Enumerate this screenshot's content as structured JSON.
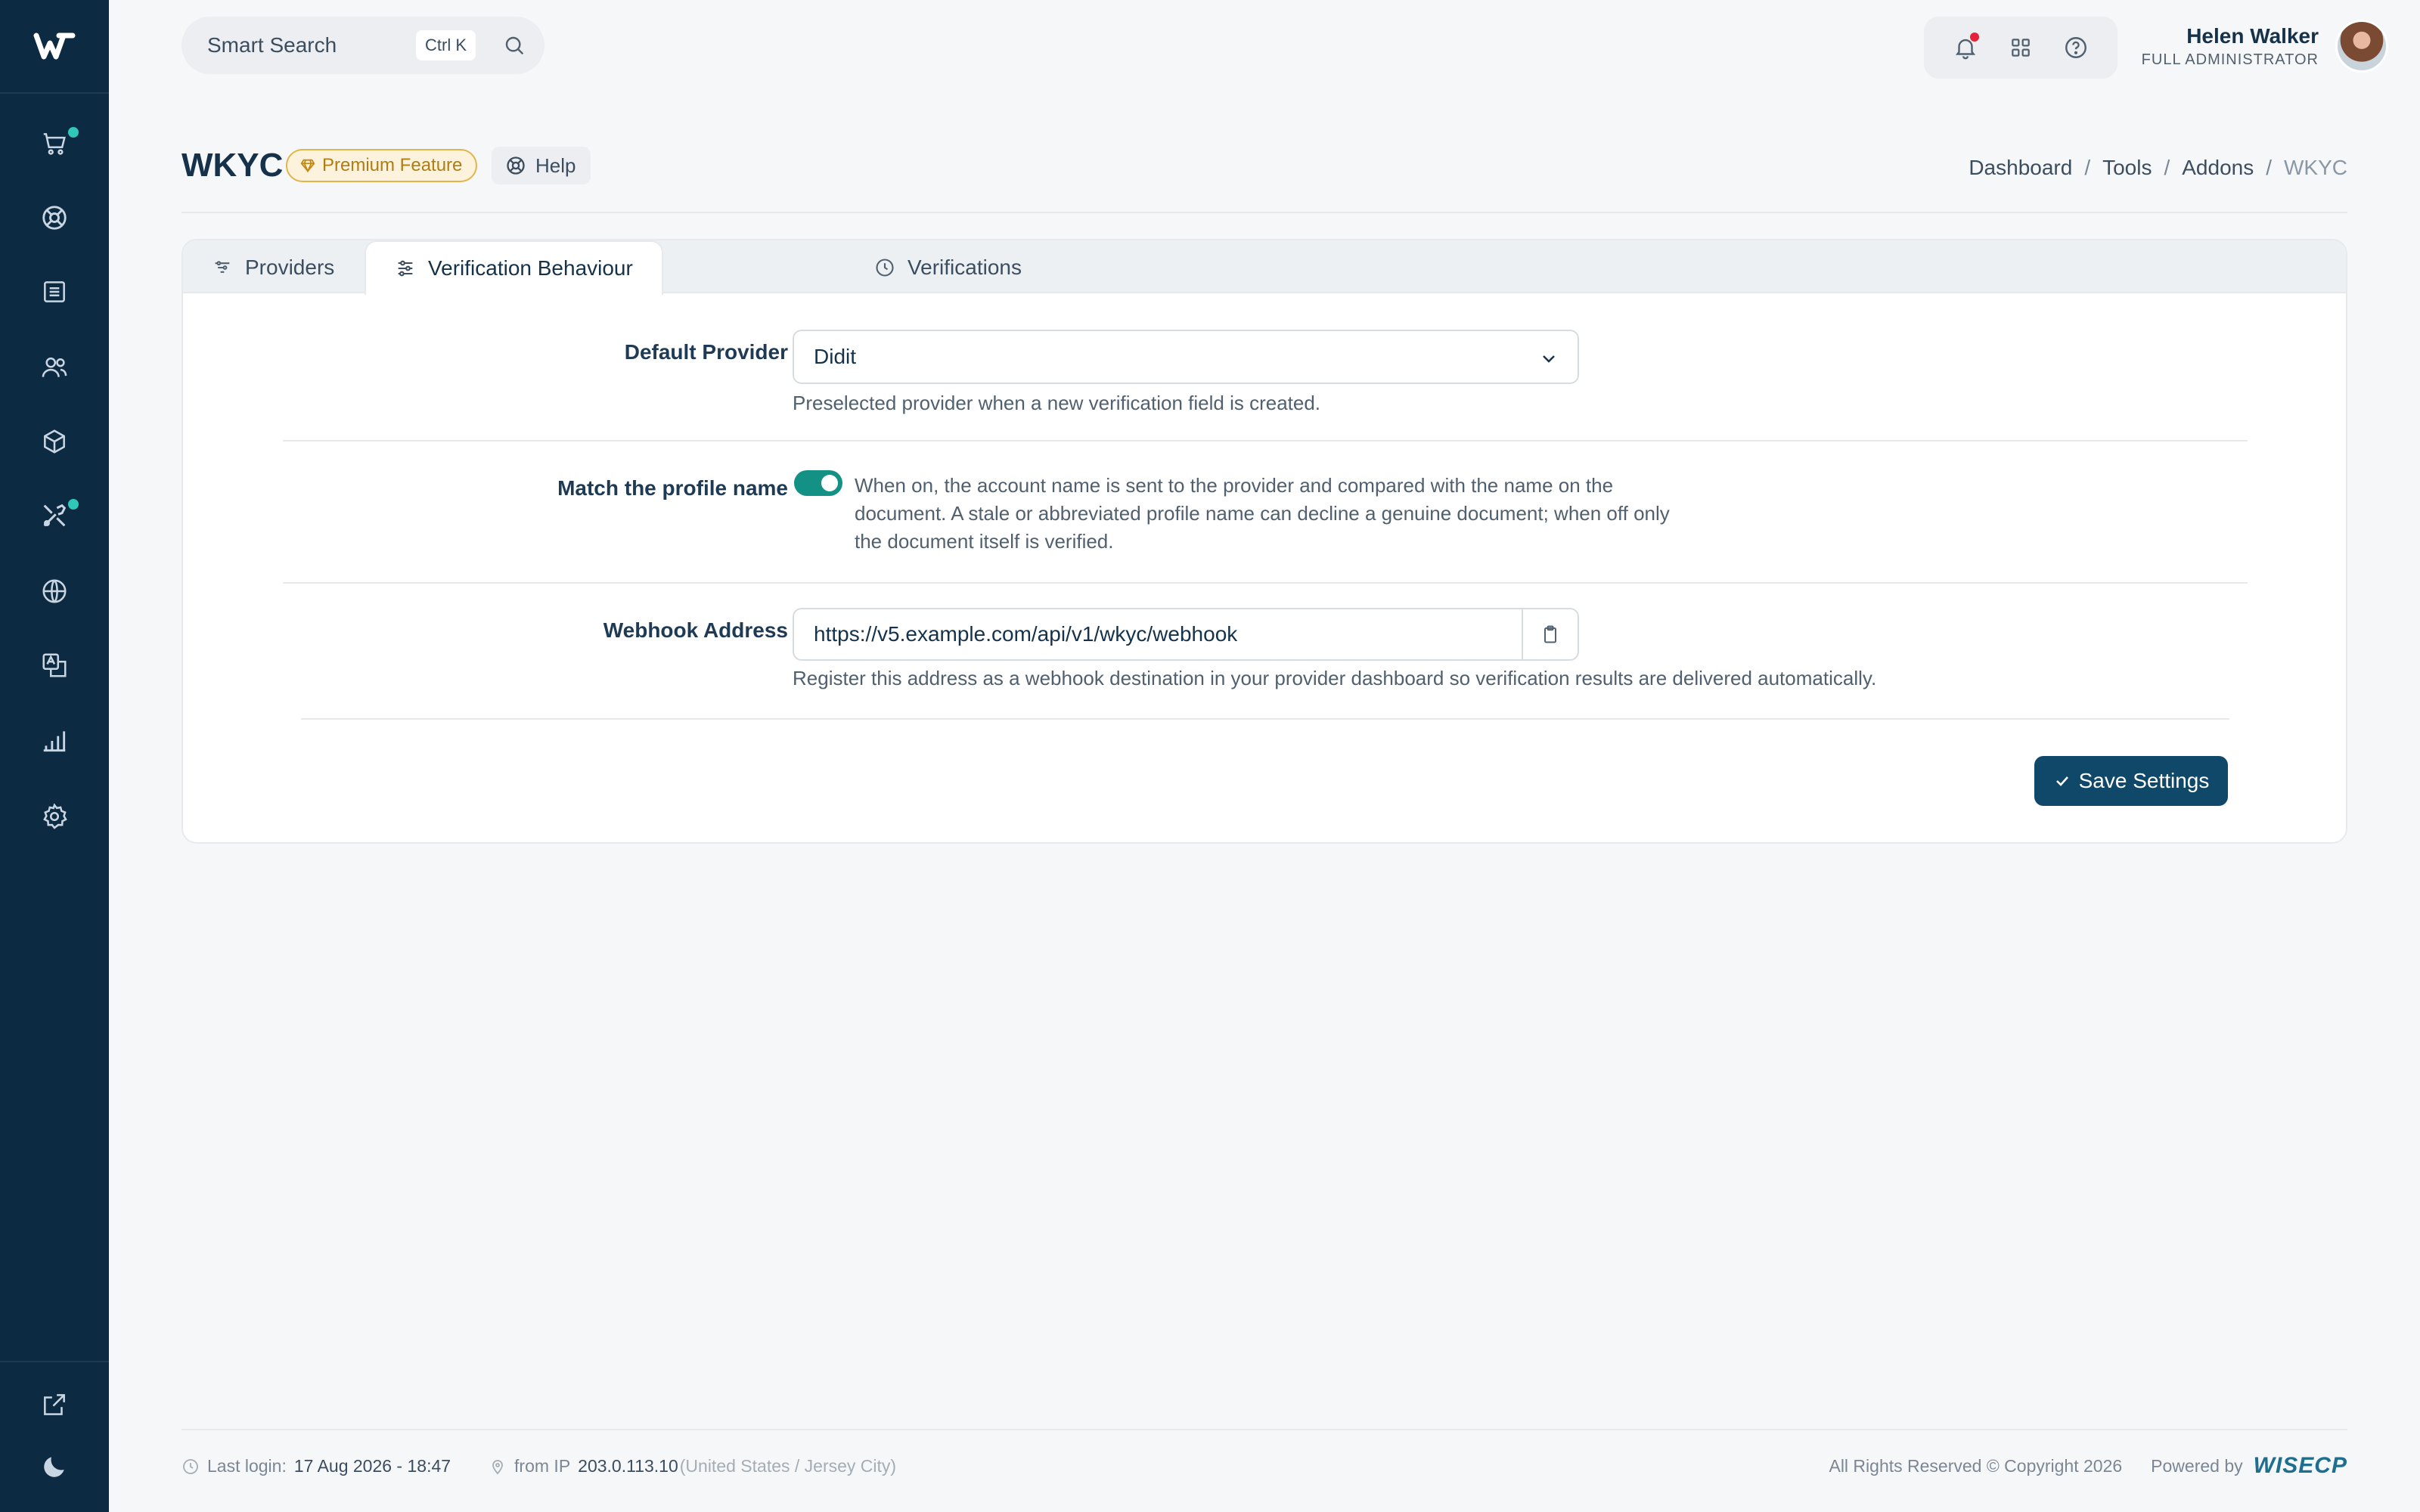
{
  "app": {
    "brand_initial": "W"
  },
  "search": {
    "placeholder": "Smart Search",
    "shortcut": "Ctrl K"
  },
  "user": {
    "name": "Helen Walker",
    "role": "FULL ADMINISTRATOR"
  },
  "header": {
    "title": "WKYC",
    "premium_badge": "Premium Feature",
    "help_label": "Help",
    "breadcrumb": [
      "Dashboard",
      "Tools",
      "Addons",
      "WKYC"
    ]
  },
  "tabs": [
    {
      "label": "Providers",
      "icon": "sliders-icon"
    },
    {
      "label": "Verification Behaviour",
      "icon": "settings-sliders-icon",
      "active": true
    },
    {
      "label": "Verifications",
      "icon": "clock-icon"
    }
  ],
  "form": {
    "default_provider": {
      "label": "Default Provider",
      "value": "Didit",
      "hint": "Preselected provider when a new verification field is created."
    },
    "match_profile": {
      "label": "Match the profile name",
      "enabled": true,
      "description": "When on, the account name is sent to the provider and compared with the name on the document. A stale or abbreviated profile name can decline a genuine document; when off only the document itself is verified."
    },
    "webhook": {
      "label": "Webhook Address",
      "value": "https://v5.example.com/api/v1/wkyc/webhook",
      "hint": "Register this address as a webhook destination in your provider dashboard so verification results are delivered automatically."
    },
    "save_label": "Save Settings"
  },
  "footer": {
    "last_login_label": "Last login:",
    "last_login_value": "17 Aug 2026 - 18:47",
    "ip_label": "from IP",
    "ip_value": "203.0.113.10",
    "ip_location": "(United States / Jersey City)",
    "copyright": "All Rights Reserved © Copyright 2026",
    "powered_by": "Powered by",
    "powered_brand": "WISECP"
  },
  "colors": {
    "sidebar": "#0d2a43",
    "accent": "#149185",
    "primary_button": "#0f4868",
    "notification_dot": "#e5243b",
    "nav_dot": "#2ec7b8"
  }
}
